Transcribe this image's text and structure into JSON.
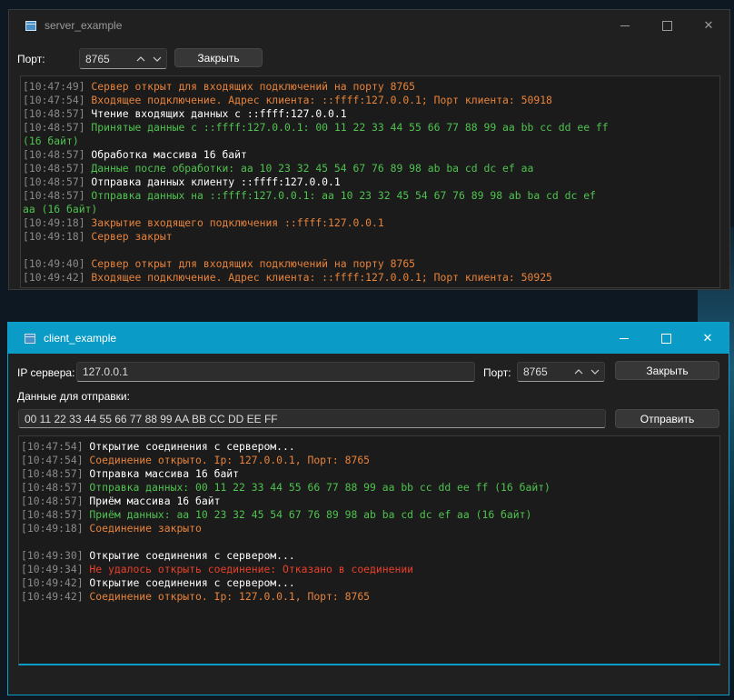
{
  "server": {
    "title": "server_example",
    "port_label": "Порт:",
    "port_value": "8765",
    "close_label": "Закрыть",
    "log": [
      {
        "ts": "[10:47:49]",
        "text": "Сервер открыт для входящих подключений на порту 8765",
        "color": "orange"
      },
      {
        "ts": "[10:47:54]",
        "text": "Входящее подключение. Адрес клиента: ::ffff:127.0.0.1; Порт клиента: 50918",
        "color": "orange"
      },
      {
        "ts": "[10:48:57]",
        "text": "Чтение входящих данных с ::ffff:127.0.0.1",
        "color": "white"
      },
      {
        "ts": "[10:48:57]",
        "text": "Принятые данные с ::ffff:127.0.0.1: 00 11 22 33 44 55 66 77 88 99 aa bb cc dd ee ff",
        "wrap": "(16 байт)",
        "color": "green"
      },
      {
        "ts": "[10:48:57]",
        "text": "Обработка массива 16 байт",
        "color": "white"
      },
      {
        "ts": "[10:48:57]",
        "text": "Данные после обработки: aa 10 23 32 45 54 67 76 89 98 ab ba cd dc ef aa",
        "color": "green"
      },
      {
        "ts": "[10:48:57]",
        "text": "Отправка данных клиенту ::ffff:127.0.0.1",
        "color": "white"
      },
      {
        "ts": "[10:48:57]",
        "text": "Отправка данных на ::ffff:127.0.0.1: aa 10 23 32 45 54 67 76 89 98 ab ba cd dc ef",
        "wrap": "aa (16 байт)",
        "color": "green"
      },
      {
        "ts": "[10:49:18]",
        "text": "Закрытие входящего подключения ::ffff:127.0.0.1",
        "color": "orange"
      },
      {
        "ts": "[10:49:18]",
        "text": "Сервер закрыт",
        "color": "orange"
      },
      {
        "blank": true
      },
      {
        "ts": "[10:49:40]",
        "text": "Сервер открыт для входящих подключений на порту 8765",
        "color": "orange"
      },
      {
        "ts": "[10:49:42]",
        "text": "Входящее подключение. Адрес клиента: ::ffff:127.0.0.1; Порт клиента: 50925",
        "color": "orange"
      }
    ]
  },
  "client": {
    "title": "client_example",
    "ip_label": "IP сервера:",
    "ip_value": "127.0.0.1",
    "port_label": "Порт:",
    "port_value": "8765",
    "close_label": "Закрыть",
    "data_label": "Данные для отправки:",
    "data_value": "00 11 22 33 44 55 66 77 88 99 AA BB CC DD EE FF",
    "send_label": "Отправить",
    "log": [
      {
        "ts": "[10:47:54]",
        "text": "Открытие соединения с сервером...",
        "color": "white"
      },
      {
        "ts": "[10:47:54]",
        "text": "Соединение открыто. Ip: 127.0.0.1, Порт: 8765",
        "color": "orange"
      },
      {
        "ts": "[10:48:57]",
        "text": "Отправка массива 16 байт",
        "color": "white"
      },
      {
        "ts": "[10:48:57]",
        "text": "Отправка данных: 00 11 22 33 44 55 66 77 88 99 aa bb cc dd ee ff (16 байт)",
        "color": "green"
      },
      {
        "ts": "[10:48:57]",
        "text": "Приём массива 16 байт",
        "color": "white"
      },
      {
        "ts": "[10:48:57]",
        "text": "Приём данных: aa 10 23 32 45 54 67 76 89 98 ab ba cd dc ef aa (16 байт)",
        "color": "green"
      },
      {
        "ts": "[10:49:18]",
        "text": "Соединение закрыто",
        "color": "orange"
      },
      {
        "blank": true
      },
      {
        "ts": "[10:49:30]",
        "text": "Открытие соединения с сервером...",
        "color": "white"
      },
      {
        "ts": "[10:49:34]",
        "text": "Не удалось открыть соединение: Отказано в соединении",
        "color": "red"
      },
      {
        "ts": "[10:49:42]",
        "text": "Открытие соединения с сервером...",
        "color": "white"
      },
      {
        "ts": "[10:49:42]",
        "text": "Соединение открыто. Ip: 127.0.0.1, Порт: 8765",
        "color": "orange"
      }
    ]
  },
  "colors": {
    "accent": "#0a9cc6",
    "log_white": "#ffffff",
    "log_orange": "#e8833a",
    "log_green": "#4fc24f",
    "log_red": "#e8402a",
    "timestamp": "#8a8a8a"
  },
  "icons": {
    "window_icon": "window-icon",
    "spin": "up-down-chevron-icon",
    "minimize": "minimize-icon",
    "maximize": "maximize-icon",
    "close": "close-icon"
  }
}
